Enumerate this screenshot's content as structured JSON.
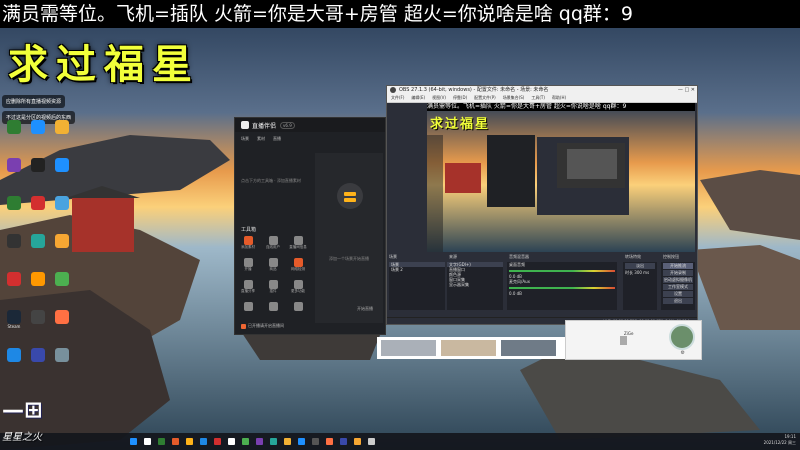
{
  "banner": {
    "text": "满员需等位。飞机=插队 火箭=你是大哥+房管 超火=你说啥是啥 qq群：9"
  },
  "overlay_title": "求过福星",
  "notes": [
    "应删除所有直播视频资源",
    "不过这是分区的视频后的东西"
  ],
  "desktop_icons": [
    {
      "label": "",
      "color": "#2f7d32"
    },
    {
      "label": "",
      "color": "#1e90ff"
    },
    {
      "label": "",
      "color": "#f2b134"
    },
    {
      "label": "",
      "color": "#7a3fb0"
    },
    {
      "label": "",
      "color": "#222222"
    },
    {
      "label": "",
      "color": "#1e90ff"
    },
    {
      "label": "",
      "color": "#2e7d32"
    },
    {
      "label": "",
      "color": "#d32f2f"
    },
    {
      "label": "",
      "color": "#4aa3df"
    },
    {
      "label": "",
      "color": "#333333"
    },
    {
      "label": "",
      "color": "#26a69a"
    },
    {
      "label": "",
      "color": "#f7a733"
    },
    {
      "label": "",
      "color": "#d32f2f"
    },
    {
      "label": "",
      "color": "#ff9800"
    },
    {
      "label": "",
      "color": "#4caf50"
    },
    {
      "label": "Steam",
      "color": "#1b2838"
    },
    {
      "label": "",
      "color": "#444444"
    },
    {
      "label": "",
      "color": "#ff7043"
    },
    {
      "label": "",
      "color": "#1e88e5"
    },
    {
      "label": "",
      "color": "#3949ab"
    },
    {
      "label": "",
      "color": "#78909c"
    }
  ],
  "stream_app": {
    "title": "直播伴侣",
    "version": "v6.9",
    "tabs": [
      "场景",
      "素材",
      "直播"
    ],
    "hint": "点击下方的工具箱 · 添加直播素材",
    "add_hint": "添加一个场景开始直播",
    "tools_title": "工具箱",
    "tools": [
      {
        "label": "添加素材",
        "color": "#e55b2a"
      },
      {
        "label": "连线用户",
        "color": "#888888"
      },
      {
        "label": "直播间信息",
        "color": "#888888"
      },
      {
        "label": "开播",
        "color": "#888888"
      },
      {
        "label": "商品",
        "color": "#888888"
      },
      {
        "label": "网络检测",
        "color": "#e55b2a"
      },
      {
        "label": "直播分享",
        "color": "#888888"
      },
      {
        "label": "插件",
        "color": "#888888"
      },
      {
        "label": "更多功能",
        "color": "#888888"
      },
      {
        "label": "",
        "color": "#888888"
      },
      {
        "label": "",
        "color": "#888888"
      },
      {
        "label": "",
        "color": "#888888"
      }
    ],
    "bottom_text": "已开播请开启直播间",
    "right_btn": "开始直播"
  },
  "obs": {
    "title": "OBS 27.1.3 (64-bit, windows) - 配置文件: 未命名 - 场景: 未命名",
    "window_buttons": "— □ ✕",
    "menu": [
      "文件(F)",
      "编辑(E)",
      "视图(V)",
      "停靠(D)",
      "配置文件(P)",
      "场景集合(S)",
      "工具(T)",
      "帮助(H)"
    ],
    "preview_ticker": "满员需等位。飞机=插队 火箭=你是大哥+房管 超火=你说啥是啥 qq群：9",
    "preview_title": "求过福星",
    "scenes_header": "场景",
    "scenes": [
      "场景",
      "场景 2"
    ],
    "sources_header": "来源",
    "sources": [
      "文字(GDI+)",
      "直播窗口",
      "颜色源",
      "窗口采集",
      "显示器采集"
    ],
    "mixer_header": "音频混音器",
    "mixer": [
      {
        "name": "桌面音频",
        "value": "0.0 dB"
      },
      {
        "name": "麦克风/Aux",
        "value": "0.0 dB"
      }
    ],
    "transitions_header": "转场特效",
    "transition_name": "淡出",
    "transition_duration": "时长 300 ms",
    "controls_header": "控制按钮",
    "controls": [
      "开始推流",
      "开始录制",
      "启动虚拟摄像机",
      "工作室模式",
      "设置",
      "退出"
    ],
    "status": "LIVE: 00:00:00   REC: 00:00:00   CPU: 2.1%, 30.00 fps"
  },
  "popup": {
    "name": "ZiGe"
  },
  "taskbar": {
    "icons": [
      "#1e90ff",
      "#ffffff",
      "#2f7d32",
      "#e55b2a",
      "#ffb31a",
      "#1e88e5",
      "#d32f2f",
      "#ffffff",
      "#4caf50",
      "#7a3fb0",
      "#26a69a",
      "#f2b134",
      "#1e90ff",
      "#555555",
      "#ff7043",
      "#3949ab",
      "#f7a733",
      "#cccccc"
    ],
    "time": "19:11",
    "date": "2021/12/22 周三"
  },
  "watermark": "星星之火"
}
